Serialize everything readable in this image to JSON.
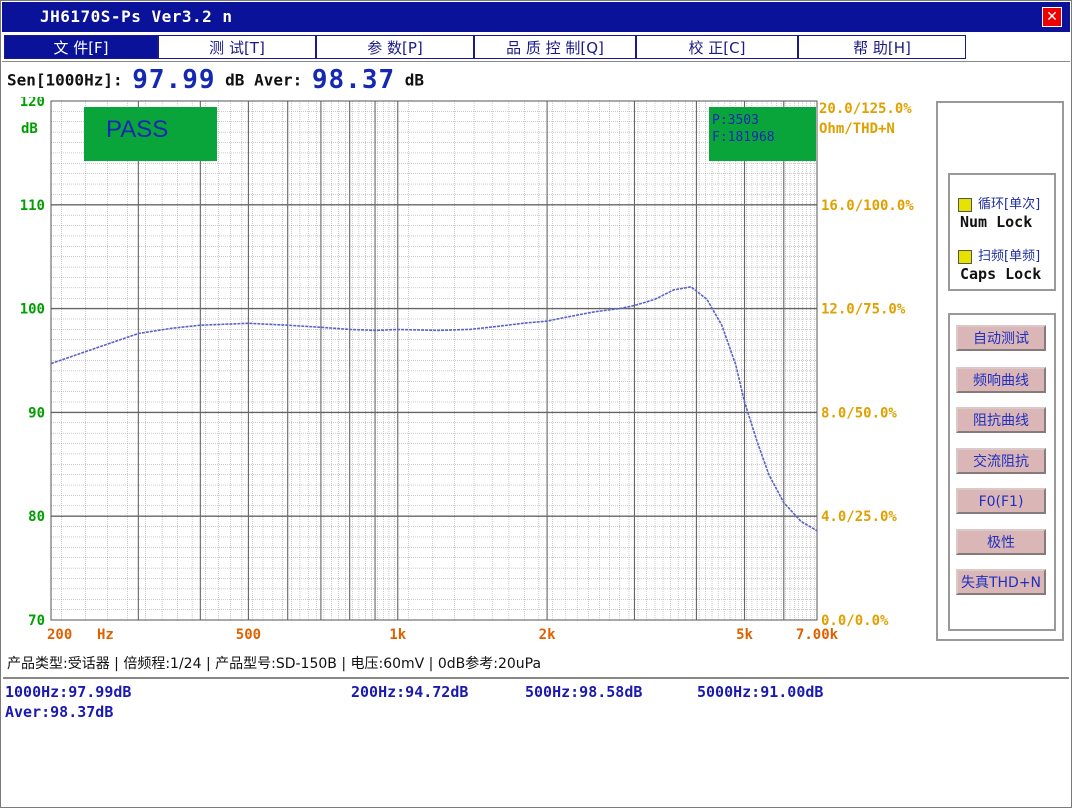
{
  "window": {
    "title": "JH6170S-Ps    Ver3.2  n"
  },
  "menu": [
    {
      "label": "文 件[F]"
    },
    {
      "label": "测 试[T]"
    },
    {
      "label": "参 数[P]"
    },
    {
      "label": "品 质 控 制[Q]"
    },
    {
      "label": "校 正[C]"
    },
    {
      "label": "帮 助[H]"
    }
  ],
  "readout": {
    "sen_label": "Sen[1000Hz]:",
    "sen_value": "97.99",
    "unit": "dB",
    "aver_label": "Aver:",
    "aver_value": "98.37",
    "unit2": "dB"
  },
  "plot": {
    "pass_label": "PASS",
    "info_p": "P:3503",
    "info_f": "F:181968",
    "left_unit": "dB",
    "right_title_1": "20.0/125.0%",
    "right_title_2": "Ohm/THD+N",
    "y_left_ticks": [
      {
        "value": 120,
        "label": "120"
      },
      {
        "value": 110,
        "label": "110"
      },
      {
        "value": 100,
        "label": "100"
      },
      {
        "value": 90,
        "label": "90"
      },
      {
        "value": 80,
        "label": "80"
      },
      {
        "value": 70,
        "label": "70"
      }
    ],
    "y_right_ticks": [
      {
        "value": 110,
        "label": "16.0/100.0%"
      },
      {
        "value": 100,
        "label": "12.0/75.0%"
      },
      {
        "value": 90,
        "label": "8.0/50.0%"
      },
      {
        "value": 80,
        "label": "4.0/25.0%"
      },
      {
        "value": 70,
        "label": "0.0/0.0%"
      }
    ],
    "x_ticks": [
      {
        "value": 200,
        "label": "200"
      },
      {
        "value": 500,
        "label": "500"
      },
      {
        "value": 1000,
        "label": "1k"
      },
      {
        "value": 2000,
        "label": "2k"
      },
      {
        "value": 5000,
        "label": "5k"
      },
      {
        "value": 7000,
        "label": "7.00k"
      }
    ],
    "x_unit": "Hz",
    "colors": {
      "grid_major": "#666666",
      "grid_minor": "#9a9a9a",
      "curve": "#5a64c8",
      "left_axis": "#00a000",
      "right_axis": "#e0a000",
      "x_axis": "#e06000",
      "badge": "#0aa53a"
    }
  },
  "chart_data": {
    "type": "line",
    "xscale": "log",
    "xlim": [
      200,
      7000
    ],
    "ylim": [
      70,
      120
    ],
    "ylabel": "dB",
    "xlabel": "Hz",
    "series": [
      {
        "x": [
          200,
          250,
          300,
          350,
          400,
          450,
          500,
          600,
          700,
          800,
          900,
          1000,
          1200,
          1400,
          1600,
          1800,
          2000,
          2200,
          2500,
          2800,
          3000,
          3300,
          3600,
          3900,
          4200,
          4500,
          4800,
          5000,
          5300,
          5600,
          6000,
          6500,
          7000
        ],
        "y": [
          94.7,
          96.3,
          97.6,
          98.1,
          98.4,
          98.5,
          98.58,
          98.4,
          98.2,
          98.0,
          97.9,
          97.99,
          97.9,
          98.0,
          98.3,
          98.6,
          98.8,
          99.2,
          99.7,
          100.0,
          100.3,
          100.9,
          101.8,
          102.1,
          100.9,
          98.4,
          94.6,
          91.0,
          87.2,
          84.0,
          81.3,
          79.5,
          78.6
        ]
      }
    ]
  },
  "side": {
    "check1": "循环[单次]",
    "lock1": "Num  Lock",
    "check2": "扫频[单频]",
    "lock2": "Caps  Lock",
    "buttons": [
      "自动测试",
      "频响曲线",
      "阻抗曲线",
      "交流阻抗",
      "F0(F1)",
      "极性",
      "失真THD+N"
    ]
  },
  "status": {
    "text": "产品类型:受话器  |  倍频程:1/24  |  产品型号:SD-150B  |  电压:60mV  |  0dB参考:20uPa"
  },
  "results": {
    "r1": "1000Hz:97.99dB",
    "r2": "200Hz:94.72dB",
    "r3": "500Hz:98.58dB",
    "r4": "5000Hz:91.00dB",
    "r5": "Aver:98.37dB"
  }
}
